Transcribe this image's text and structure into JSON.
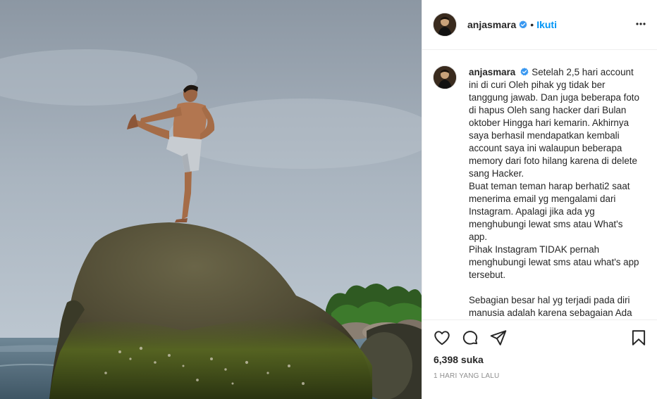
{
  "post": {
    "photo_alt": "Photo",
    "username": "anjasmara",
    "verified_badge": "verified-badge-icon",
    "separator": "•",
    "follow_label": "Ikuti",
    "more_icon": "more-options-icon"
  },
  "caption": {
    "username": "anjasmara",
    "paragraphs": [
      "Setelah 2,5 hari account ini di curi Oleh pihak yg tidak ber tanggung jawab. Dan juga beberapa foto di hapus Oleh sang hacker dari Bulan oktober Hingga hari kemarin. Akhirnya saya berhasil mendapatkan kembali account saya ini walaupun beberapa memory dari foto hilang karena di delete sang Hacker.",
      "Buat teman teman harap berhati2 saat menerima email yg mengalami dari Instagram. Apalagi jika ada yg menghubungi lewat sms atau What's app.",
      "Pihak Instagram TIDAK pernah menghubungi lewat sms atau what's app tersebut.",
      "Sebagian besar hal yg terjadi pada diri manusia adalah karena sebagaian Ada"
    ]
  },
  "actions": {
    "like_icon": "heart-icon",
    "comment_icon": "comment-icon",
    "share_icon": "share-icon",
    "save_icon": "bookmark-icon",
    "likes": "6,398 suka",
    "time": "1 HARI YANG LALU"
  },
  "colors": {
    "link_blue": "#0095f6",
    "verified_blue": "#3897f0",
    "muted_text": "#8e8e8e",
    "border": "#efefef"
  }
}
